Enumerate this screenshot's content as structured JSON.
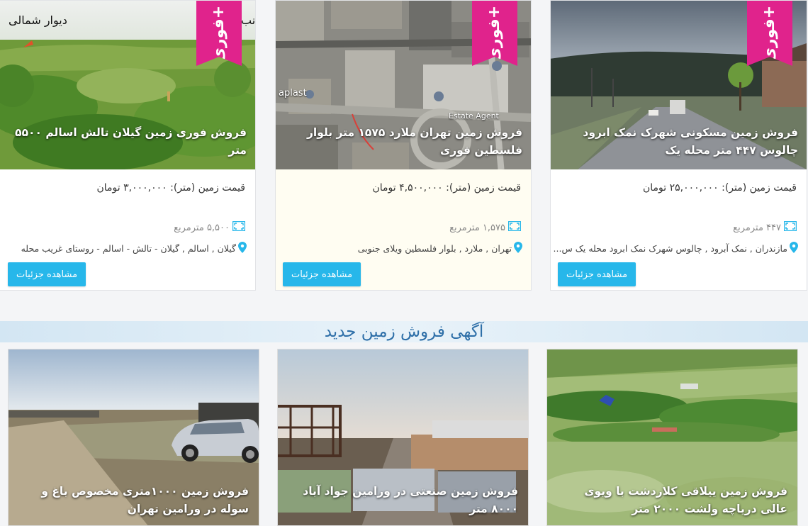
{
  "listings": [
    {
      "caption": "فروش فوری زمین گیلان تالش اسالم ۵۵۰۰ متر",
      "badge": "+فوری",
      "photo_text_left": "دیوار شمالی",
      "photo_text_right": "انب",
      "price": "قیمت زمین (متر): ۳,۰۰۰,۰۰۰ تومان",
      "area": "۵,۵۰۰ مترمربع",
      "location": "گیلان , اسالم , گیلان - تالش - اسالم - روستای غریب محله",
      "button": "مشاهده جزئیات"
    },
    {
      "caption": "فروش زمین تهران ملارد ۱۵۷۵ متر بلوار فلسطین فوری",
      "badge": "+فوری",
      "map_labels": [
        "aplast",
        "Estate Agent"
      ],
      "price": "قیمت زمین (متر): ۴,۵۰۰,۰۰۰ تومان",
      "area": "۱,۵۷۵ مترمربع",
      "location": "تهران , ملارد , بلوار فلسطین ویلای جنوبی",
      "button": "مشاهده جزئیات"
    },
    {
      "caption": "فروش زمین مسکونی شهرک نمک ابرود چالوس ۴۴۷ متر محله یک",
      "badge": "+فوری",
      "price": "قیمت زمین (متر): ۲۵,۰۰۰,۰۰۰ تومان",
      "area": "۴۴۷ مترمربع",
      "location": "مازندران , نمک آبرود , چالوس شهرک نمک ابرود محله یک س...",
      "button": "مشاهده جزئیات"
    }
  ],
  "section_title": "آگهی فروش زمین جدید",
  "new_listings": [
    {
      "caption": "فروش زمین ۱۰۰۰متری مخصوص باغ و سوله در ورامین تهران"
    },
    {
      "caption": "فروش زمین صنعتی در ورامین جواد آباد ۸۰۰۰ متر"
    },
    {
      "caption": "فروش زمین ییلاقی کلاردشت با ویوی عالی دریاچه ولشت ۲۰۰۰ متر"
    }
  ],
  "colors": {
    "badge": "#e0238c",
    "button": "#27b7ea",
    "section_title": "#2e6fa8",
    "section_bg": "#dbeaf5"
  },
  "icons": {
    "area": "area-frame-icon",
    "location": "map-pin-icon"
  }
}
